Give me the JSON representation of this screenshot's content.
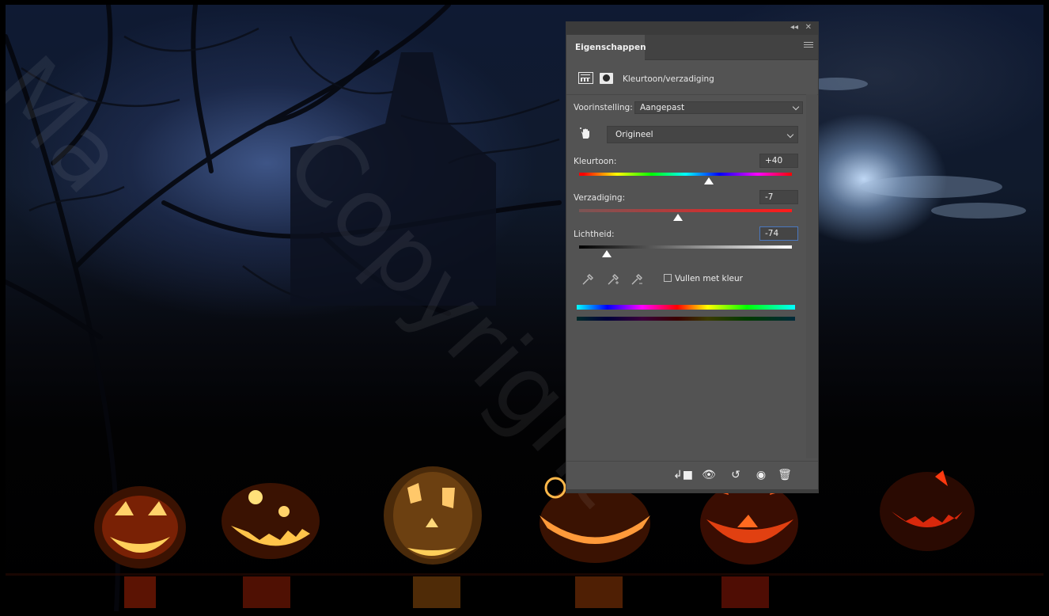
{
  "panel": {
    "tab_label": "Eigenschappen",
    "adjustment_title": "Kleurtoon/verzadiging",
    "preset": {
      "label": "Voorinstelling:",
      "value": "Aangepast"
    },
    "channel": {
      "value": "Origineel"
    },
    "sliders": {
      "hue": {
        "label": "Kleurtoon:",
        "value": "+40",
        "numeric": 40,
        "min": -180,
        "max": 180
      },
      "saturation": {
        "label": "Verzadiging:",
        "value": "-7",
        "numeric": -7,
        "min": -100,
        "max": 100
      },
      "lightness": {
        "label": "Lichtheid:",
        "value": "-74",
        "numeric": -74,
        "min": -100,
        "max": 100
      }
    },
    "colorize": {
      "label": "Vullen met kleur",
      "checked": false
    },
    "icons": {
      "collapse": "double-chevron-left-icon",
      "close": "close-icon",
      "menu": "panel-menu-icon",
      "adjustment": "hue-saturation-adjustment-icon",
      "mask": "layer-mask-icon",
      "target": "targeted-adjustment-hand-icon",
      "eyedroppers": [
        "eyedropper-icon",
        "eyedropper-plus-icon",
        "eyedropper-minus-icon"
      ],
      "bottom": [
        "clip-to-layer-icon",
        "view-previous-state-icon",
        "reset-icon",
        "visibility-eye-icon",
        "trash-icon"
      ]
    }
  },
  "colors": {
    "panel_bg": "#535353",
    "panel_dark": "#424242",
    "accent_focus": "#4a78c0"
  }
}
